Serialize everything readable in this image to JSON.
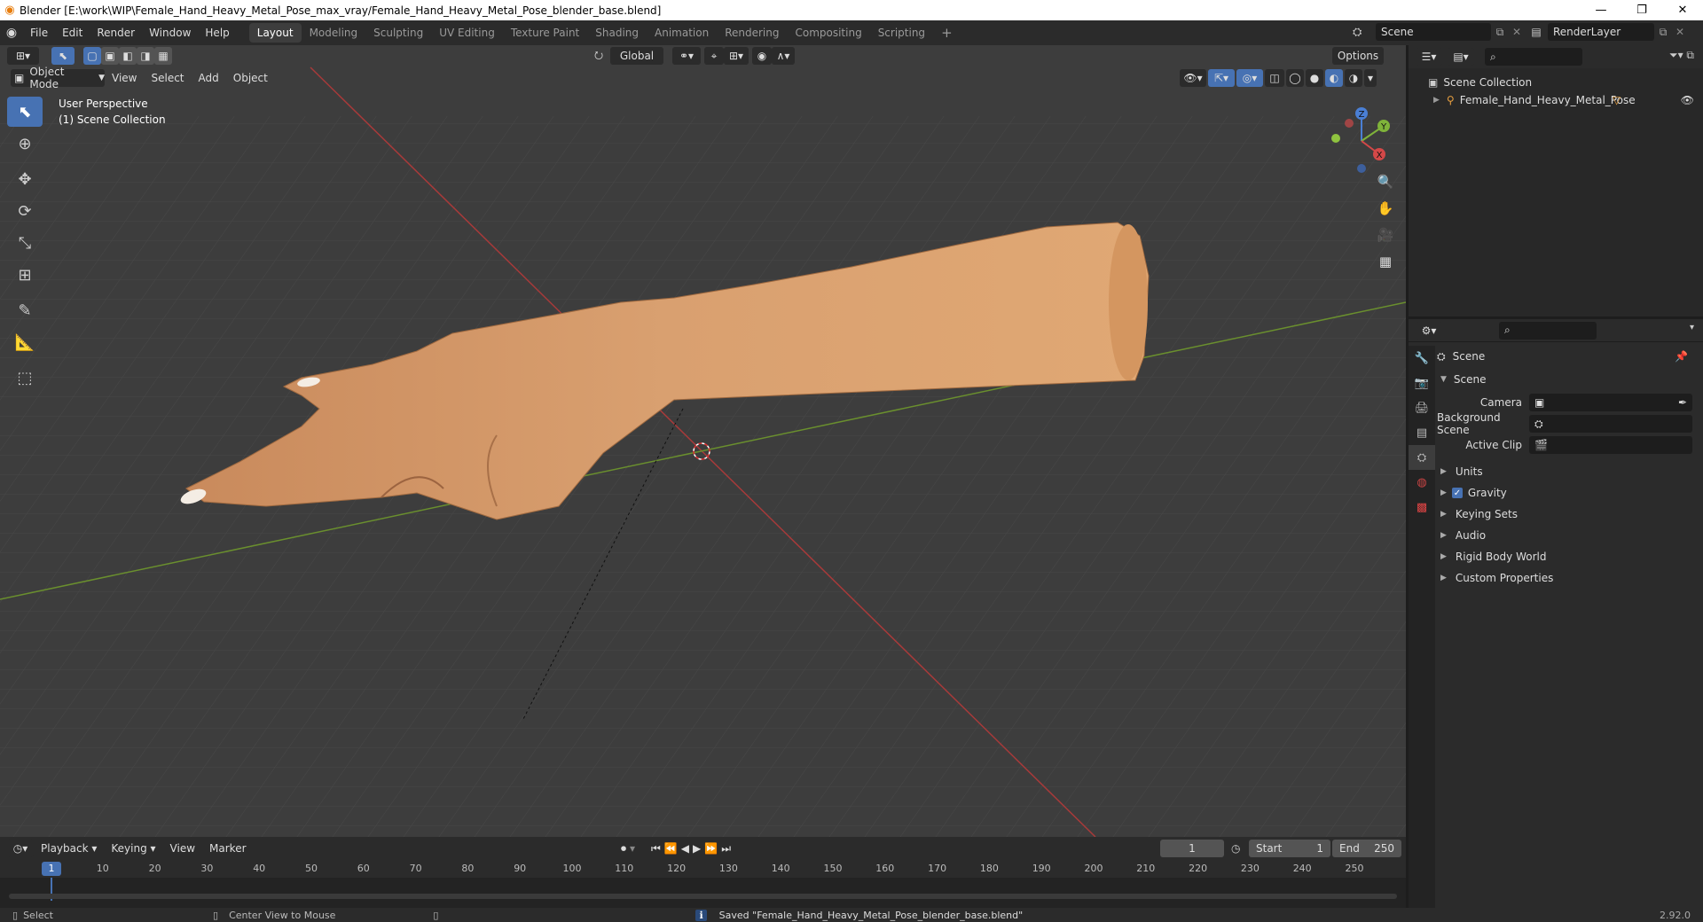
{
  "window": {
    "title": "Blender [E:\\work\\WIP\\Female_Hand_Heavy_Metal_Pose_max_vray/Female_Hand_Heavy_Metal_Pose_blender_base.blend]",
    "minimize": "—",
    "maximize": "❐",
    "close": "✕"
  },
  "menu": [
    "File",
    "Edit",
    "Render",
    "Window",
    "Help"
  ],
  "workspaces": {
    "tabs": [
      "Layout",
      "Modeling",
      "Sculpting",
      "UV Editing",
      "Texture Paint",
      "Shading",
      "Animation",
      "Rendering",
      "Compositing",
      "Scripting"
    ],
    "active": "Layout",
    "add": "+"
  },
  "scene_selector": {
    "value": "Scene"
  },
  "renderlayer_selector": {
    "value": "RenderLayer"
  },
  "viewport": {
    "mode": "Object Mode",
    "menus": [
      "View",
      "Select",
      "Add",
      "Object"
    ],
    "transform_orientation": "Global",
    "options_label": "Options",
    "overlay_text_line1": "User Perspective",
    "overlay_text_line2": "(1) Scene Collection",
    "gizmo_axes": {
      "z": "Z",
      "y": "Y",
      "x": "X"
    }
  },
  "outliner": {
    "root": "Scene Collection",
    "items": [
      {
        "label": "Female_Hand_Heavy_Metal_Pose"
      }
    ]
  },
  "properties": {
    "context": "Scene",
    "panel": "Scene",
    "fields": [
      {
        "label": "Camera",
        "value": ""
      },
      {
        "label": "Background Scene",
        "value": ""
      },
      {
        "label": "Active Clip",
        "value": ""
      }
    ],
    "sections": [
      {
        "label": "Units",
        "checkbox": false
      },
      {
        "label": "Gravity",
        "checkbox": true
      },
      {
        "label": "Keying Sets",
        "checkbox": false
      },
      {
        "label": "Audio",
        "checkbox": false
      },
      {
        "label": "Rigid Body World",
        "checkbox": false
      },
      {
        "label": "Custom Properties",
        "checkbox": false
      }
    ]
  },
  "timeline": {
    "menus": [
      "Playback",
      "Keying",
      "View",
      "Marker"
    ],
    "current_frame": "1",
    "start_label": "Start",
    "start_value": "1",
    "end_label": "End",
    "end_value": "250",
    "ruler": [
      "10",
      "20",
      "30",
      "40",
      "50",
      "60",
      "70",
      "80",
      "90",
      "100",
      "110",
      "120",
      "130",
      "140",
      "150",
      "160",
      "170",
      "180",
      "190",
      "200",
      "210",
      "220",
      "230",
      "240",
      "250"
    ],
    "playhead_label": "1"
  },
  "status": {
    "select": "Select",
    "center_view": "Center View to Mouse",
    "message": "Saved \"Female_Hand_Heavy_Metal_Pose_blender_base.blend\"",
    "version": "2.92.0"
  }
}
